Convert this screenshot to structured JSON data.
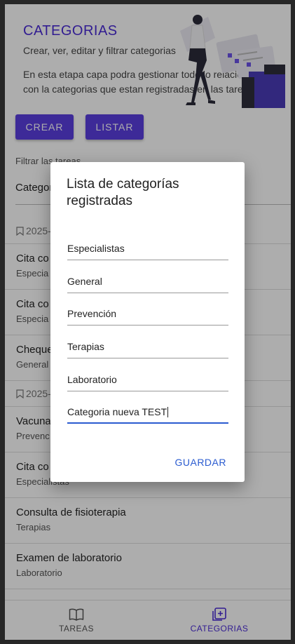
{
  "header": {
    "title": "CATEGORIAS",
    "subtitle": "Crear, ver, editar y filtrar categorias",
    "description": "En esta etapa capa podra gestionar todo lo relacionado con la categorias que estan registradas en las tareas"
  },
  "actions": {
    "create_label": "CREAR",
    "list_label": "LISTAR"
  },
  "filter": {
    "label": "Filtrar las tareas",
    "selected": "Categoria"
  },
  "groups": [
    {
      "date": "2025-",
      "items": [
        {
          "title": "Cita co",
          "category": "Especia"
        },
        {
          "title": "Cita co",
          "category": "Especia"
        },
        {
          "title": "Cheque",
          "category": "General"
        }
      ]
    },
    {
      "date": "2025-",
      "items": [
        {
          "title": "Vacuna",
          "category": "Prevenc"
        },
        {
          "title": "Cita co",
          "category": "Especialistas"
        },
        {
          "title": "Consulta de fisioterapia",
          "category": "Terapias"
        },
        {
          "title": "Examen de laboratorio",
          "category": "Laboratorio"
        }
      ]
    }
  ],
  "tabs": {
    "tareas": "TAREAS",
    "categorias": "CATEGORIAS"
  },
  "dialog": {
    "title": "Lista de categorías registradas",
    "categories": [
      "Especialistas",
      "General",
      "Prevención",
      "Terapias",
      "Laboratorio"
    ],
    "new_category_value": "Categoria nueva TEST",
    "save_label": "GUARDAR"
  },
  "colors": {
    "accent": "#5b3fe0",
    "link": "#2a5bd0"
  }
}
